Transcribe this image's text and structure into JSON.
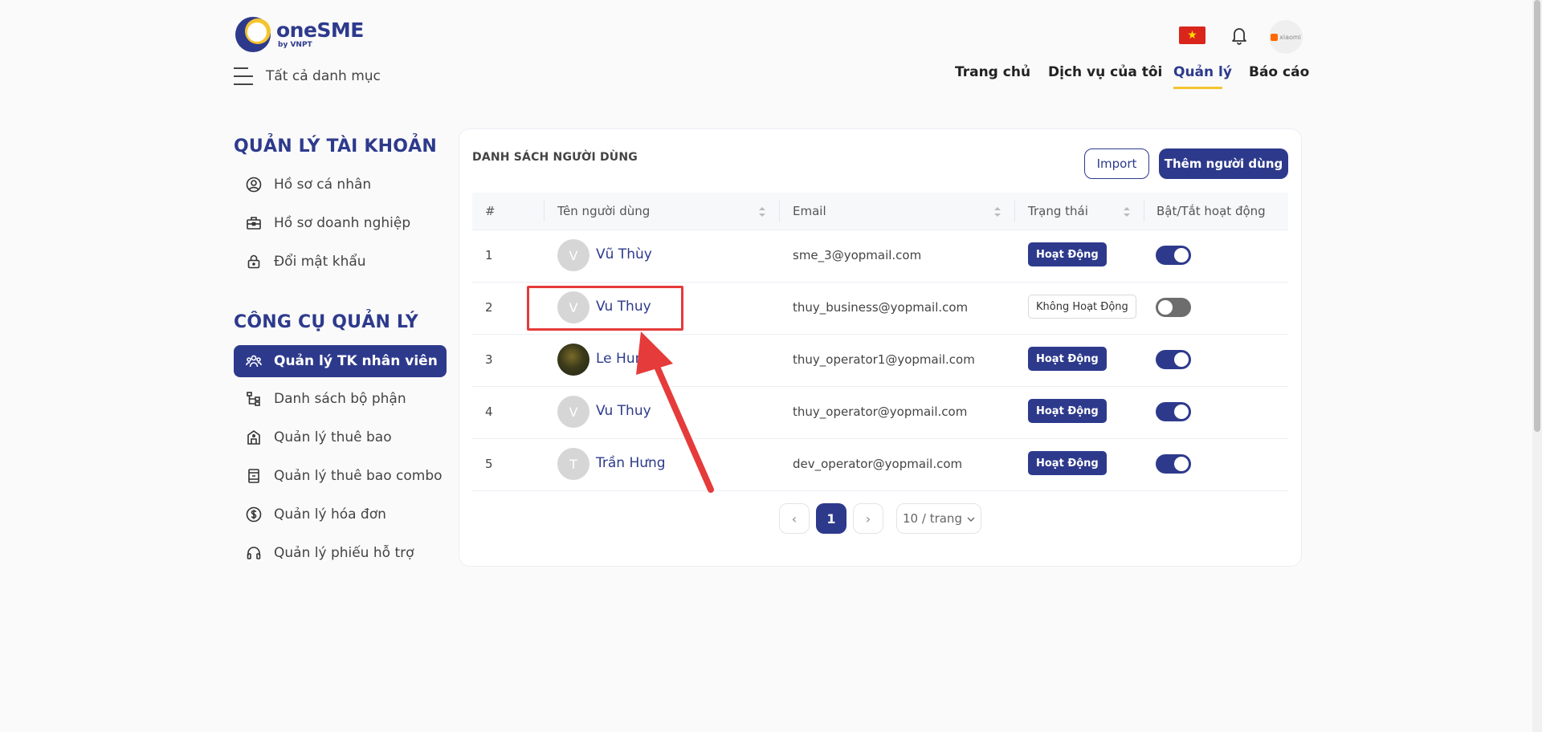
{
  "header": {
    "logo": {
      "name": "oneSME",
      "sub": "by VNPT"
    },
    "all_categories": "Tất cả danh mục",
    "avatar_brand": "xiaomi",
    "nav": [
      "Trang chủ",
      "Dịch vụ của tôi",
      "Quản lý",
      "Báo cáo"
    ],
    "nav_active": "Quản lý"
  },
  "sidebar": {
    "section1_title": "QUẢN LÝ TÀI KHOẢN",
    "section1_items": [
      {
        "label": "Hồ sơ cá nhân",
        "icon": "user-circle-icon"
      },
      {
        "label": "Hồ sơ doanh nghiệp",
        "icon": "briefcase-icon"
      },
      {
        "label": "Đổi mật khẩu",
        "icon": "lock-icon"
      }
    ],
    "section2_title": "CÔNG CỤ QUẢN LÝ",
    "section2_items": [
      {
        "label": "Quản lý TK nhân viên",
        "icon": "users-icon",
        "active": true
      },
      {
        "label": "Danh sách bộ phận",
        "icon": "org-tree-icon"
      },
      {
        "label": "Quản lý thuê bao",
        "icon": "building-icon"
      },
      {
        "label": "Quản lý thuê bao combo",
        "icon": "combo-icon"
      },
      {
        "label": "Quản lý hóa đơn",
        "icon": "dollar-circle-icon"
      },
      {
        "label": "Quản lý phiếu hỗ trợ",
        "icon": "headset-icon"
      }
    ]
  },
  "main": {
    "title": "DANH SÁCH NGƯỜI DÙNG",
    "import_label": "Import",
    "add_label": "Thêm người dùng",
    "columns": [
      "#",
      "Tên người dùng",
      "Email",
      "Trạng thái",
      "Bật/Tắt hoạt động"
    ],
    "rows": [
      {
        "index": "1",
        "initial": "V",
        "name": "Vũ Thùy",
        "email": "sme_3@yopmail.com",
        "status": "Hoạt Động",
        "enabled": true
      },
      {
        "index": "2",
        "initial": "V",
        "name": "Vu Thuy",
        "email": "thuy_business@yopmail.com",
        "status": "Không Hoạt Động",
        "enabled": false
      },
      {
        "index": "3",
        "initial": "",
        "name": "Le Hung",
        "email": "thuy_operator1@yopmail.com",
        "status": "Hoạt Động",
        "enabled": true
      },
      {
        "index": "4",
        "initial": "V",
        "name": "Vu Thuy",
        "email": "thuy_operator@yopmail.com",
        "status": "Hoạt Động",
        "enabled": true
      },
      {
        "index": "5",
        "initial": "T",
        "name": "Trần Hưng",
        "email": "dev_operator@yopmail.com",
        "status": "Hoạt Động",
        "enabled": true
      }
    ],
    "pagination": {
      "prev": "‹",
      "current": "1",
      "next": "›",
      "page_size": "10 / trang"
    }
  },
  "colors": {
    "brand": "#2d3a8c",
    "accent": "#f4c430",
    "annotation": "#e53b3b"
  }
}
